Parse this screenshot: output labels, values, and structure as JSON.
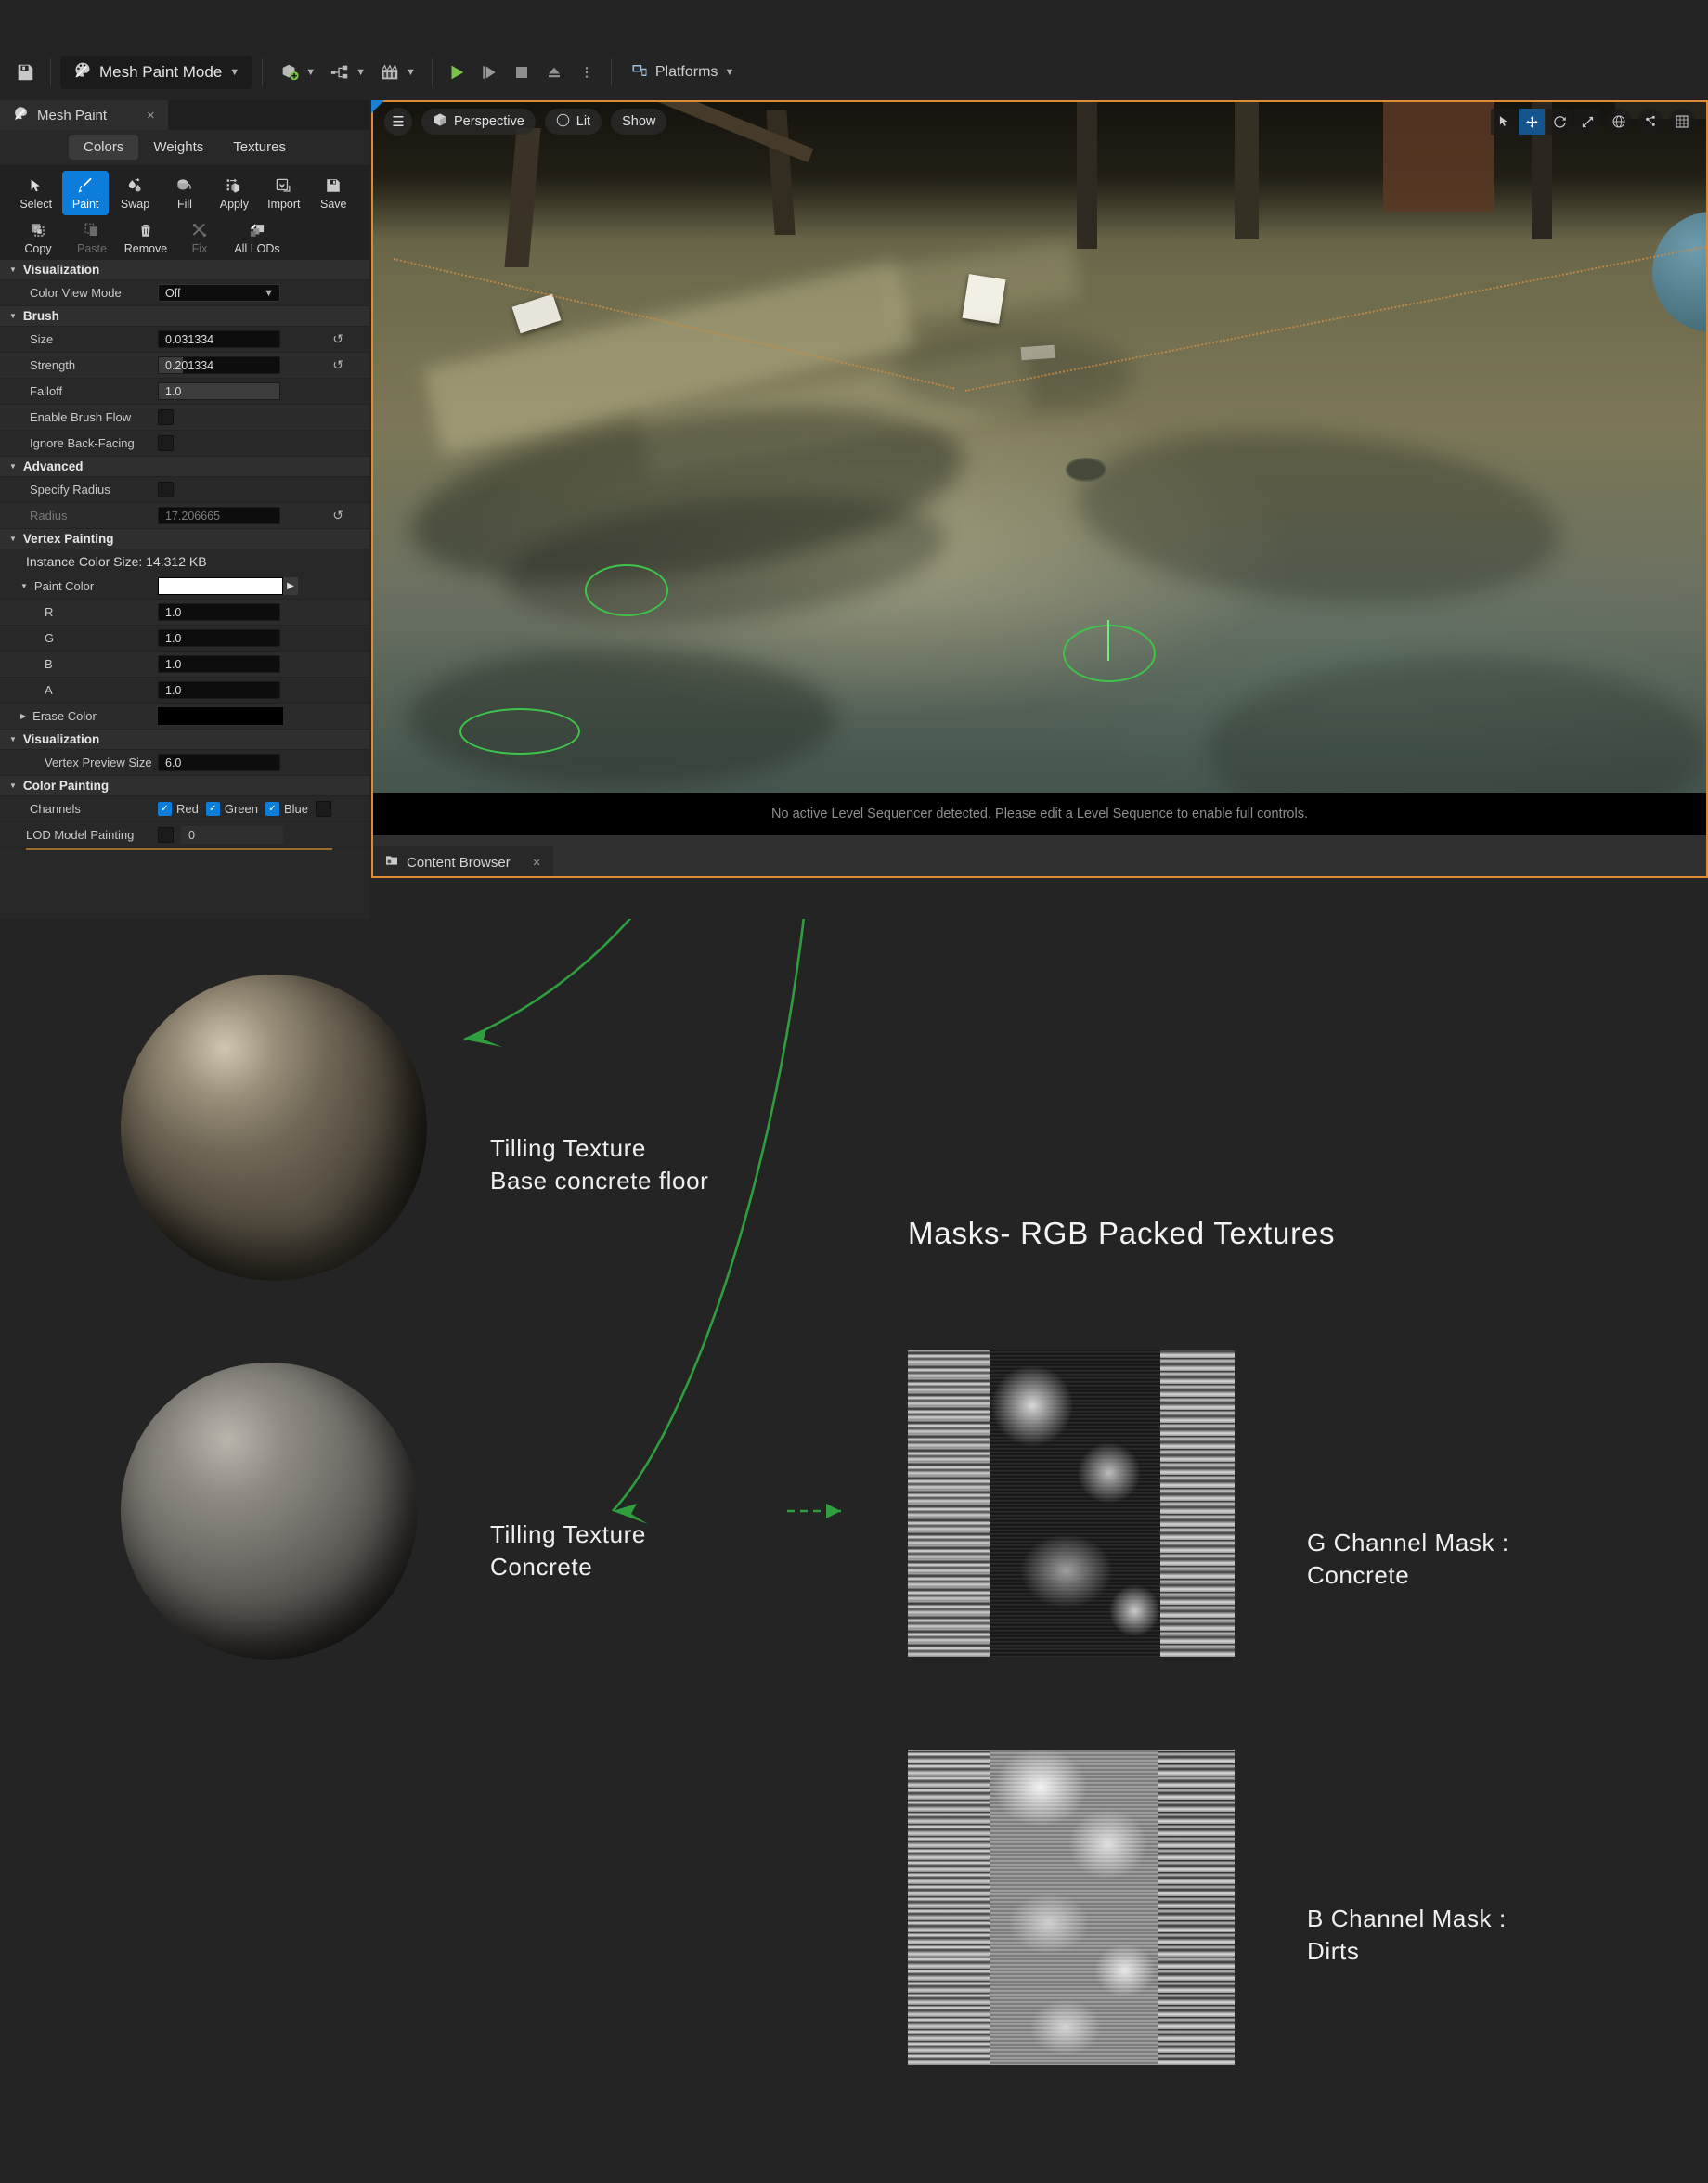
{
  "toolbar": {
    "save_icon": "save-icon",
    "mode_label": "Mesh Paint Mode",
    "mode_icon": "paintbrush-palette-icon",
    "add_icon": "add-actor-icon",
    "blueprint_icon": "blueprint-icon",
    "cinematics_icon": "cinematics-icon",
    "play_icon": "play-icon",
    "step_icon": "skip-icon",
    "stop_icon": "stop-icon",
    "eject_icon": "eject-icon",
    "more_icon": "more-options-icon",
    "platforms_label": "Platforms",
    "platforms_icon": "platforms-icon"
  },
  "panel": {
    "tab_label": "Mesh Paint",
    "tab_icon": "paintbrush-palette-icon",
    "close_label": "×",
    "segments": [
      {
        "label": "Colors",
        "active": true
      },
      {
        "label": "Weights",
        "active": false
      },
      {
        "label": "Textures",
        "active": false
      }
    ],
    "tools_row1": [
      {
        "label": "Select",
        "icon": "cursor-arrow-icon",
        "state": "normal"
      },
      {
        "label": "Paint",
        "icon": "paintbrush-icon",
        "state": "selected"
      },
      {
        "label": "Swap",
        "icon": "swap-droplets-icon",
        "state": "normal"
      },
      {
        "label": "Fill",
        "icon": "paint-bucket-icon",
        "state": "normal"
      },
      {
        "label": "Apply",
        "icon": "apply-cube-icon",
        "state": "normal"
      },
      {
        "label": "Import",
        "icon": "import-icon",
        "state": "normal"
      },
      {
        "label": "Save",
        "icon": "floppy-disk-icon",
        "state": "normal"
      }
    ],
    "tools_row2": [
      {
        "label": "Copy",
        "icon": "copy-icon",
        "state": "normal"
      },
      {
        "label": "Paste",
        "icon": "paste-icon",
        "state": "disabled"
      },
      {
        "label": "Remove",
        "icon": "trash-icon",
        "state": "normal"
      },
      {
        "label": "Fix",
        "icon": "wrench-screwdriver-icon",
        "state": "disabled"
      },
      {
        "label": "All LODs",
        "icon": "all-lods-icon",
        "state": "normal"
      }
    ],
    "sections": {
      "visualization1": "Visualization",
      "brush": "Brush",
      "advanced": "Advanced",
      "vertex_painting": "Vertex Painting",
      "visualization2": "Visualization",
      "color_painting": "Color Painting"
    },
    "fields": {
      "color_view_mode_label": "Color View Mode",
      "color_view_mode_value": "Off",
      "size_label": "Size",
      "size_value": "0.031334",
      "strength_label": "Strength",
      "strength_value": "0.201334",
      "falloff_label": "Falloff",
      "falloff_value": "1.0",
      "enable_brush_flow_label": "Enable Brush Flow",
      "ignore_back_facing_label": "Ignore Back-Facing",
      "specify_radius_label": "Specify Radius",
      "radius_label": "Radius",
      "radius_value": "17.206665",
      "instance_color_size": "Instance Color Size: 14.312 KB",
      "paint_color_label": "Paint Color",
      "paint_color_hex": "#ffffff",
      "r_label": "R",
      "r_value": "1.0",
      "g_label": "G",
      "g_value": "1.0",
      "b_label": "B",
      "b_value": "1.0",
      "a_label": "A",
      "a_value": "1.0",
      "erase_color_label": "Erase Color",
      "erase_color_hex": "#000000",
      "vertex_preview_size_label": "Vertex Preview Size",
      "vertex_preview_size_value": "6.0",
      "channels_label": "Channels",
      "channel_red": "Red",
      "channel_green": "Green",
      "channel_blue": "Blue",
      "lod_model_painting_label": "LOD Model Painting",
      "lod_model_painting_value": "0"
    }
  },
  "viewport": {
    "hamburger_icon": "hamburger-menu-icon",
    "perspective_label": "Perspective",
    "perspective_icon": "cube-icon",
    "lit_label": "Lit",
    "lit_icon": "lit-sphere-icon",
    "show_label": "Show",
    "gizmos": [
      {
        "icon": "select-arrow-icon",
        "active": false
      },
      {
        "icon": "translate-icon",
        "active": true
      },
      {
        "icon": "rotate-icon",
        "active": false
      },
      {
        "icon": "scale-icon",
        "active": false
      },
      {
        "icon": "world-coords-icon",
        "active": false
      },
      {
        "icon": "snap-icon",
        "active": false
      },
      {
        "icon": "grid-snap-icon",
        "active": false
      }
    ],
    "status_message": "No active Level Sequencer detected. Please edit a Level Sequence to enable full controls.",
    "content_browser_label": "Content Browser",
    "content_browser_icon": "content-browser-icon",
    "content_browser_close": "×"
  },
  "annotations": {
    "accent_color": "#2f9e3f",
    "label_tilling_base_line1": "Tilling Texture",
    "label_tilling_base_line2": "Base concrete floor",
    "label_tilling_concrete_line1": "Tilling Texture",
    "label_tilling_concrete_line2": "Concrete",
    "masks_title": "Masks- RGB Packed Textures",
    "g_channel_line1": "G Channel Mask :",
    "g_channel_line2": "Concrete",
    "b_channel_line1": "B Channel Mask :",
    "b_channel_line2": "Dirts"
  }
}
